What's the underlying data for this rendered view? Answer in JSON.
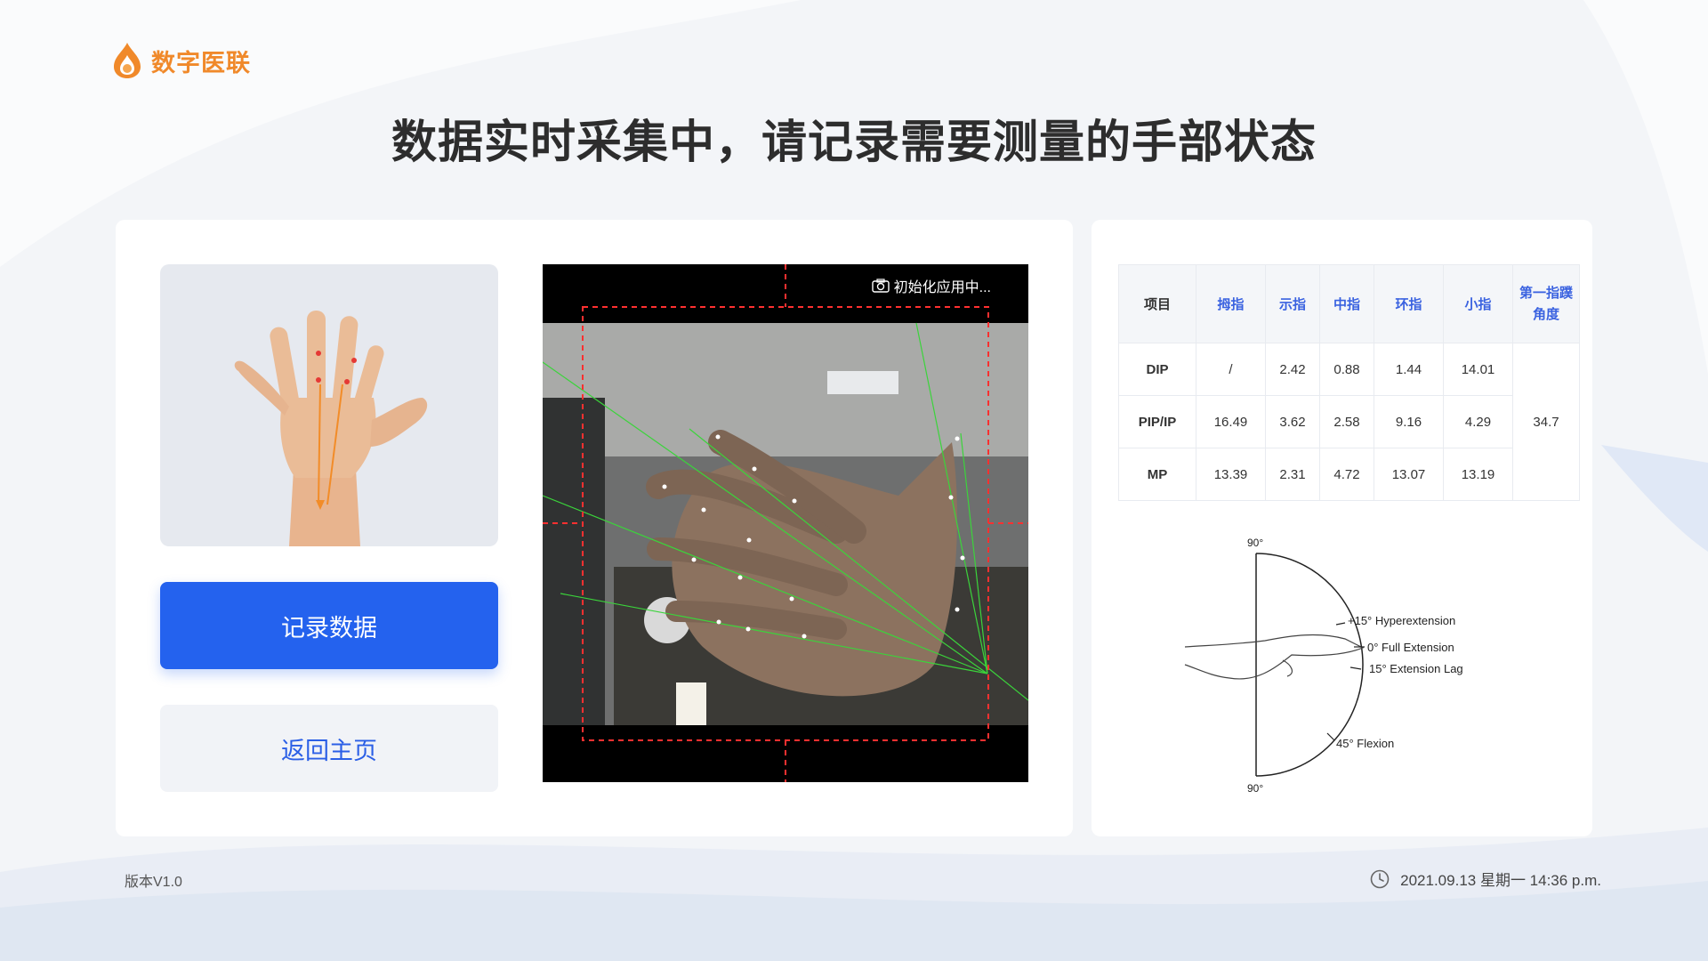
{
  "app": {
    "brand": "数字医联",
    "brand_color": "#f0892a",
    "logo_icon": "flame-drop-icon"
  },
  "page": {
    "title": "数据实时采集中，请记录需要测量的手部状态"
  },
  "actions": {
    "record_label": "记录数据",
    "home_label": "返回主页",
    "primary_color": "#2462ee"
  },
  "camera": {
    "status": "初始化应用中...",
    "status_icon": "camera-icon"
  },
  "table": {
    "headers": [
      "项目",
      "拇指",
      "示指",
      "中指",
      "环指",
      "小指",
      "第一指蹼角度"
    ],
    "rows": [
      {
        "label": "DIP",
        "values": [
          "/",
          "2.42",
          "0.88",
          "1.44",
          "14.01"
        ]
      },
      {
        "label": "PIP/IP",
        "values": [
          "16.49",
          "3.62",
          "2.58",
          "9.16",
          "4.29"
        ]
      },
      {
        "label": "MP",
        "values": [
          "13.39",
          "2.31",
          "4.72",
          "13.07",
          "13.19"
        ]
      }
    ],
    "web_angle": "34.7"
  },
  "diagram": {
    "labels": {
      "top": "90°",
      "bottom": "90°",
      "hyper": "+15° Hyperextension",
      "full": "0° Full Extension",
      "lag": "15° Extension Lag",
      "flexion": "45° Flexion"
    }
  },
  "footer": {
    "version": "版本V1.0",
    "datetime": "2021.09.13 星期一 14:36 p.m.",
    "clock_icon": "clock-icon"
  }
}
